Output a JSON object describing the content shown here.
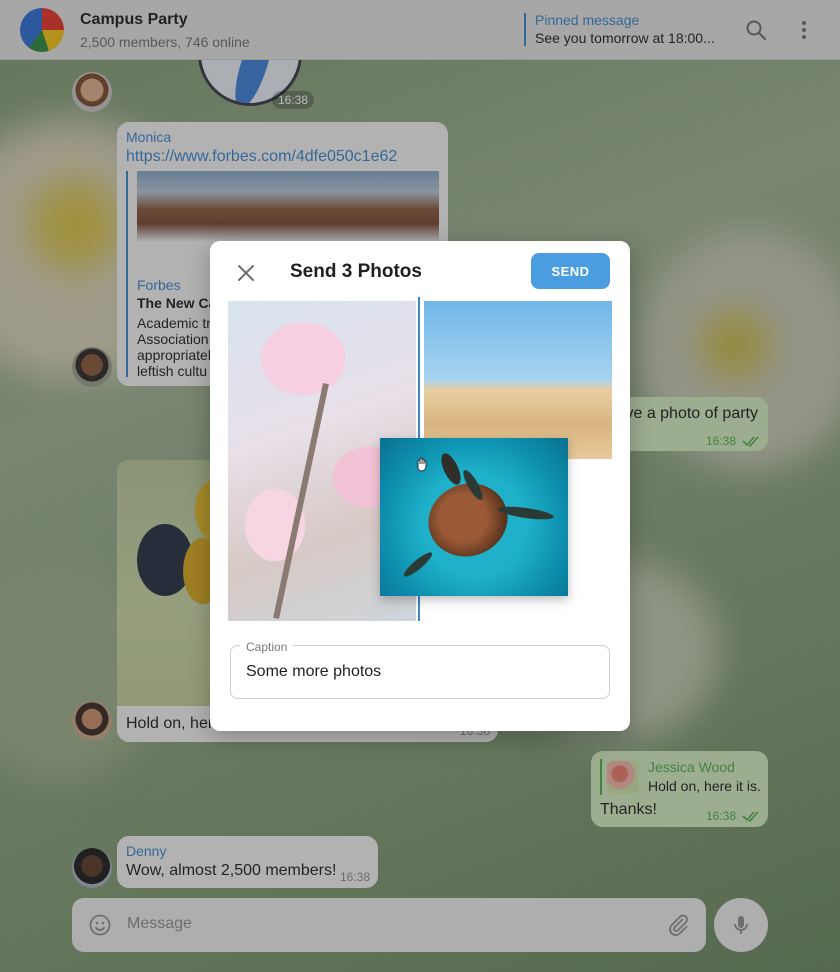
{
  "header": {
    "title": "Campus Party",
    "subtitle": "2,500 members, 746 online",
    "pinned_title": "Pinned message",
    "pinned_text": "See you tomorrow at 18:00...",
    "icons": [
      "search-icon",
      "more-vert-icon"
    ]
  },
  "messages": {
    "sticker_time": "16:38",
    "monica": {
      "sender": "Monica",
      "link": "https://www.forbes.com/4dfe050c1e62",
      "preview_site": "Forbes",
      "preview_title": "The New Ca",
      "preview_lines": [
        "Academic tr",
        "Association",
        "appropriatel",
        "leftish cultu"
      ]
    },
    "party_photo": {
      "text": "ve a photo of party",
      "time": "16:38"
    },
    "hold_on": {
      "text": "Hold on, here",
      "time": "16:38"
    },
    "reply": {
      "quoted_sender": "Jessica Wood",
      "quoted_text": "Hold on, here it is.",
      "text": "Thanks!",
      "time": "16:38"
    },
    "denny": {
      "sender": "Denny",
      "text": "Wow, almost 2,500 members!",
      "time": "16:38"
    }
  },
  "composer": {
    "placeholder": "Message"
  },
  "modal": {
    "title": "Send 3 Photos",
    "send_label": "SEND",
    "caption_label": "Caption",
    "caption_value": "Some more photos"
  },
  "colors": {
    "accent": "#4a9de0",
    "link": "#3a86cf",
    "outgoing_bubble": "#d5ecc1",
    "read_check": "#4fae4e"
  }
}
